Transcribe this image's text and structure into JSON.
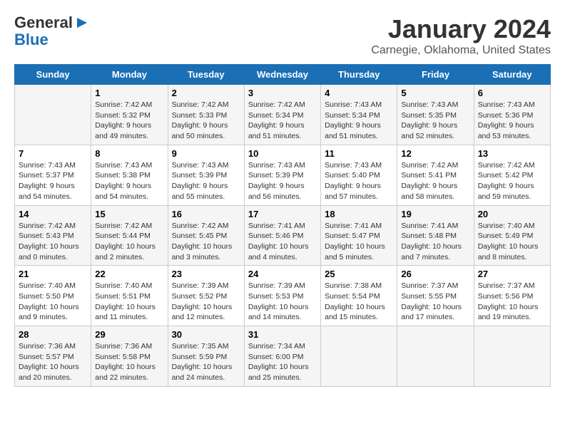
{
  "logo": {
    "line1": "General",
    "line2": "Blue"
  },
  "title": "January 2024",
  "subtitle": "Carnegie, Oklahoma, United States",
  "days_of_week": [
    "Sunday",
    "Monday",
    "Tuesday",
    "Wednesday",
    "Thursday",
    "Friday",
    "Saturday"
  ],
  "weeks": [
    [
      {
        "day": "",
        "info": ""
      },
      {
        "day": "1",
        "info": "Sunrise: 7:42 AM\nSunset: 5:32 PM\nDaylight: 9 hours\nand 49 minutes."
      },
      {
        "day": "2",
        "info": "Sunrise: 7:42 AM\nSunset: 5:33 PM\nDaylight: 9 hours\nand 50 minutes."
      },
      {
        "day": "3",
        "info": "Sunrise: 7:42 AM\nSunset: 5:34 PM\nDaylight: 9 hours\nand 51 minutes."
      },
      {
        "day": "4",
        "info": "Sunrise: 7:43 AM\nSunset: 5:34 PM\nDaylight: 9 hours\nand 51 minutes."
      },
      {
        "day": "5",
        "info": "Sunrise: 7:43 AM\nSunset: 5:35 PM\nDaylight: 9 hours\nand 52 minutes."
      },
      {
        "day": "6",
        "info": "Sunrise: 7:43 AM\nSunset: 5:36 PM\nDaylight: 9 hours\nand 53 minutes."
      }
    ],
    [
      {
        "day": "7",
        "info": "Sunrise: 7:43 AM\nSunset: 5:37 PM\nDaylight: 9 hours\nand 54 minutes."
      },
      {
        "day": "8",
        "info": "Sunrise: 7:43 AM\nSunset: 5:38 PM\nDaylight: 9 hours\nand 54 minutes."
      },
      {
        "day": "9",
        "info": "Sunrise: 7:43 AM\nSunset: 5:39 PM\nDaylight: 9 hours\nand 55 minutes."
      },
      {
        "day": "10",
        "info": "Sunrise: 7:43 AM\nSunset: 5:39 PM\nDaylight: 9 hours\nand 56 minutes."
      },
      {
        "day": "11",
        "info": "Sunrise: 7:43 AM\nSunset: 5:40 PM\nDaylight: 9 hours\nand 57 minutes."
      },
      {
        "day": "12",
        "info": "Sunrise: 7:42 AM\nSunset: 5:41 PM\nDaylight: 9 hours\nand 58 minutes."
      },
      {
        "day": "13",
        "info": "Sunrise: 7:42 AM\nSunset: 5:42 PM\nDaylight: 9 hours\nand 59 minutes."
      }
    ],
    [
      {
        "day": "14",
        "info": "Sunrise: 7:42 AM\nSunset: 5:43 PM\nDaylight: 10 hours\nand 0 minutes."
      },
      {
        "day": "15",
        "info": "Sunrise: 7:42 AM\nSunset: 5:44 PM\nDaylight: 10 hours\nand 2 minutes."
      },
      {
        "day": "16",
        "info": "Sunrise: 7:42 AM\nSunset: 5:45 PM\nDaylight: 10 hours\nand 3 minutes."
      },
      {
        "day": "17",
        "info": "Sunrise: 7:41 AM\nSunset: 5:46 PM\nDaylight: 10 hours\nand 4 minutes."
      },
      {
        "day": "18",
        "info": "Sunrise: 7:41 AM\nSunset: 5:47 PM\nDaylight: 10 hours\nand 5 minutes."
      },
      {
        "day": "19",
        "info": "Sunrise: 7:41 AM\nSunset: 5:48 PM\nDaylight: 10 hours\nand 7 minutes."
      },
      {
        "day": "20",
        "info": "Sunrise: 7:40 AM\nSunset: 5:49 PM\nDaylight: 10 hours\nand 8 minutes."
      }
    ],
    [
      {
        "day": "21",
        "info": "Sunrise: 7:40 AM\nSunset: 5:50 PM\nDaylight: 10 hours\nand 9 minutes."
      },
      {
        "day": "22",
        "info": "Sunrise: 7:40 AM\nSunset: 5:51 PM\nDaylight: 10 hours\nand 11 minutes."
      },
      {
        "day": "23",
        "info": "Sunrise: 7:39 AM\nSunset: 5:52 PM\nDaylight: 10 hours\nand 12 minutes."
      },
      {
        "day": "24",
        "info": "Sunrise: 7:39 AM\nSunset: 5:53 PM\nDaylight: 10 hours\nand 14 minutes."
      },
      {
        "day": "25",
        "info": "Sunrise: 7:38 AM\nSunset: 5:54 PM\nDaylight: 10 hours\nand 15 minutes."
      },
      {
        "day": "26",
        "info": "Sunrise: 7:37 AM\nSunset: 5:55 PM\nDaylight: 10 hours\nand 17 minutes."
      },
      {
        "day": "27",
        "info": "Sunrise: 7:37 AM\nSunset: 5:56 PM\nDaylight: 10 hours\nand 19 minutes."
      }
    ],
    [
      {
        "day": "28",
        "info": "Sunrise: 7:36 AM\nSunset: 5:57 PM\nDaylight: 10 hours\nand 20 minutes."
      },
      {
        "day": "29",
        "info": "Sunrise: 7:36 AM\nSunset: 5:58 PM\nDaylight: 10 hours\nand 22 minutes."
      },
      {
        "day": "30",
        "info": "Sunrise: 7:35 AM\nSunset: 5:59 PM\nDaylight: 10 hours\nand 24 minutes."
      },
      {
        "day": "31",
        "info": "Sunrise: 7:34 AM\nSunset: 6:00 PM\nDaylight: 10 hours\nand 25 minutes."
      },
      {
        "day": "",
        "info": ""
      },
      {
        "day": "",
        "info": ""
      },
      {
        "day": "",
        "info": ""
      }
    ]
  ]
}
